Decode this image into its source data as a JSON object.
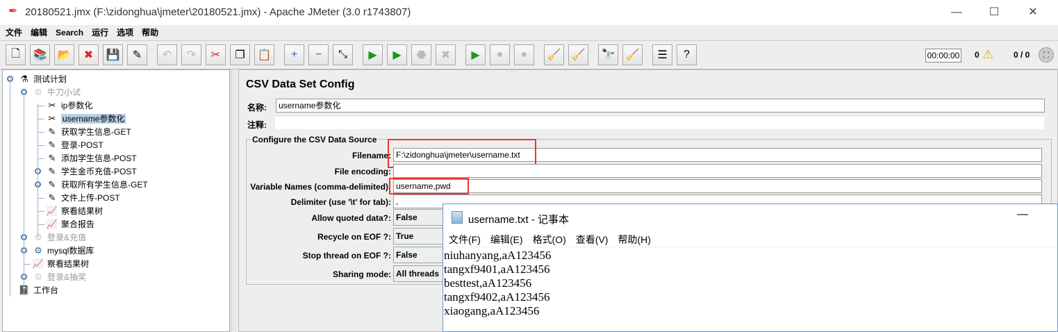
{
  "window": {
    "title": "20180521.jmx (F:\\zidonghua\\jmeter\\20180521.jmx) - Apache JMeter (3.0 r1743807)",
    "min": "—",
    "max": "☐",
    "close": "✕"
  },
  "menu": [
    "文件",
    "编辑",
    "Search",
    "运行",
    "选项",
    "帮助"
  ],
  "toolbar": [
    {
      "name": "new",
      "glyph": "🗋",
      "dis": false
    },
    {
      "name": "templates",
      "glyph": "📚",
      "dis": false
    },
    {
      "name": "open",
      "glyph": "📂",
      "dis": false
    },
    {
      "name": "close",
      "glyph": "✖",
      "dis": false
    },
    {
      "name": "save",
      "glyph": "💾",
      "dis": false
    },
    {
      "name": "save-as",
      "glyph": "✎",
      "dis": false
    },
    {
      "gap": true
    },
    {
      "name": "undo",
      "glyph": "↶",
      "dis": true
    },
    {
      "name": "redo",
      "glyph": "↷",
      "dis": true
    },
    {
      "name": "cut",
      "glyph": "✂",
      "dis": false
    },
    {
      "name": "copy",
      "glyph": "❐",
      "dis": false
    },
    {
      "name": "paste",
      "glyph": "📋",
      "dis": false
    },
    {
      "gap": true
    },
    {
      "name": "expand",
      "glyph": "+",
      "dis": false
    },
    {
      "name": "collapse",
      "glyph": "−",
      "dis": false
    },
    {
      "name": "toggle",
      "glyph": "⤡",
      "dis": false
    },
    {
      "gap": true
    },
    {
      "name": "start",
      "glyph": "▶",
      "dis": false
    },
    {
      "name": "start-no-pause",
      "glyph": "▶",
      "dis": false
    },
    {
      "name": "stop",
      "glyph": "⬣",
      "dis": true
    },
    {
      "name": "shutdown",
      "glyph": "✖",
      "dis": true
    },
    {
      "gap": true
    },
    {
      "name": "remote-start",
      "glyph": "▶",
      "dis": false
    },
    {
      "name": "remote-stop",
      "glyph": "●",
      "dis": true
    },
    {
      "name": "remote-shutdown",
      "glyph": "●",
      "dis": true
    },
    {
      "gap": true
    },
    {
      "name": "clear",
      "glyph": "🧹",
      "dis": false
    },
    {
      "name": "clear-all",
      "glyph": "🧹",
      "dis": false
    },
    {
      "gap": true
    },
    {
      "name": "search",
      "glyph": "🔭",
      "dis": false
    },
    {
      "name": "reset-search",
      "glyph": "🧹",
      "dis": false
    },
    {
      "gap": true
    },
    {
      "name": "function-helper",
      "glyph": "☰",
      "dis": false
    },
    {
      "name": "help",
      "glyph": "?",
      "dis": false
    }
  ],
  "status": {
    "timer": "00:00:00",
    "warnings": "0",
    "threads": "0 / 0"
  },
  "tree": [
    {
      "label": "测试计划",
      "level": 0,
      "icon": "⚗",
      "dim": false,
      "sel": false,
      "knob": true
    },
    {
      "label": "牛刀小试",
      "level": 1,
      "icon": "⚙",
      "dim": true,
      "sel": false,
      "knob": true
    },
    {
      "label": "ip参数化",
      "level": 2,
      "icon": "✂",
      "dim": false,
      "sel": false,
      "knob": false
    },
    {
      "label": "username参数化",
      "level": 2,
      "icon": "✂",
      "dim": false,
      "sel": true,
      "knob": false
    },
    {
      "label": "获取学生信息-GET",
      "level": 2,
      "icon": "✎",
      "dim": false,
      "sel": false,
      "knob": false
    },
    {
      "label": "登录-POST",
      "level": 2,
      "icon": "✎",
      "dim": false,
      "sel": false,
      "knob": false
    },
    {
      "label": "添加学生信息-POST",
      "level": 2,
      "icon": "✎",
      "dim": false,
      "sel": false,
      "knob": false
    },
    {
      "label": "学生金币充值-POST",
      "level": 2,
      "icon": "✎",
      "dim": false,
      "sel": false,
      "knob": true
    },
    {
      "label": "获取所有学生信息-GET",
      "level": 2,
      "icon": "✎",
      "dim": false,
      "sel": false,
      "knob": true
    },
    {
      "label": "文件上传-POST",
      "level": 2,
      "icon": "✎",
      "dim": false,
      "sel": false,
      "knob": false
    },
    {
      "label": "察看结果树",
      "level": 2,
      "icon": "📈",
      "dim": false,
      "sel": false,
      "knob": false
    },
    {
      "label": "聚合报告",
      "level": 2,
      "icon": "📈",
      "dim": false,
      "sel": false,
      "knob": false
    },
    {
      "label": "登录&充值",
      "level": 1,
      "icon": "⚙",
      "dim": true,
      "sel": false,
      "knob": true
    },
    {
      "label": "mysql数据库",
      "level": 1,
      "icon": "⚙",
      "dim": false,
      "sel": false,
      "knob": true
    },
    {
      "label": "察看结果树",
      "level": 1,
      "icon": "📈",
      "dim": false,
      "sel": false,
      "knob": false
    },
    {
      "label": "登录&抽奖",
      "level": 1,
      "icon": "⚙",
      "dim": true,
      "sel": false,
      "knob": true
    },
    {
      "label": "工作台",
      "level": 0,
      "icon": "📓",
      "dim": false,
      "sel": false,
      "knob": false
    }
  ],
  "panel": {
    "title": "CSV Data Set Config",
    "name_label": "名称:",
    "name_value": "username参数化",
    "comment_label": "注释:",
    "comment_value": "",
    "section": "Configure the CSV Data Source",
    "filename_label": "Filename:",
    "filename": "F:\\zidonghua\\jmeter\\username.txt",
    "encoding_label": "File encoding:",
    "encoding": "",
    "varnames_label": "Variable Names (comma-delimited):",
    "varnames": "username,pwd",
    "delimiter_label": "Delimiter (use '\\t' for tab):",
    "delimiter": ",",
    "quoted_label": "Allow quoted data?:",
    "quoted": "False",
    "recycle_label": "Recycle on EOF ?:",
    "recycle": "True",
    "stopthread_label": "Stop thread on EOF ?:",
    "stopthread": "False",
    "sharing_label": "Sharing mode:",
    "sharing": "All threads"
  },
  "notepad": {
    "title": "username.txt - 记事本",
    "min": "—",
    "menu": [
      "文件(F)",
      "编辑(E)",
      "格式(O)",
      "查看(V)",
      "帮助(H)"
    ],
    "lines": [
      "niuhanyang,aA123456",
      "tangxf9401,aA123456",
      "besttest,aA123456",
      "tangxf9402,aA123456",
      "xiaogang,aA123456"
    ]
  }
}
